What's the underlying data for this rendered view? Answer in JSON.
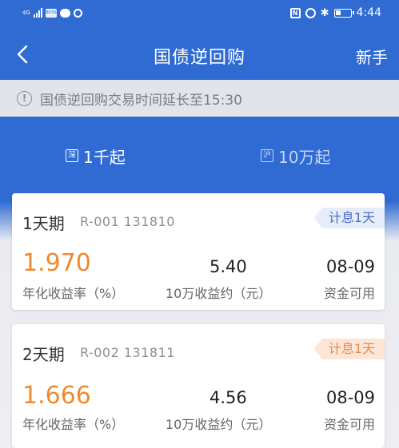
{
  "status_bar": {
    "network": "4G",
    "time": "4:44",
    "app_badge": "BOSS"
  },
  "nav": {
    "title": "国债逆回购",
    "action_label": "新手"
  },
  "notice": {
    "text": "国债逆回购交易时间延长至15:30"
  },
  "tabs": [
    {
      "icon_char": "深",
      "label": "1千起",
      "active": true
    },
    {
      "icon_char": "沪",
      "label": "10万起",
      "active": false
    }
  ],
  "products": [
    {
      "title": "1天期",
      "code": "R-001  131810",
      "badge": "计息1天",
      "rate": "1.970",
      "rate_label": "年化收益率（%）",
      "income": "5.40",
      "income_label": "10万收益约（元）",
      "date": "08-09",
      "date_label": "资金可用"
    },
    {
      "title": "2天期",
      "code": "R-002  131811",
      "badge": "计息1天",
      "rate": "1.666",
      "rate_label": "年化收益率（%）",
      "income": "4.56",
      "income_label": "10万收益约（元）",
      "date": "08-09",
      "date_label": "资金可用"
    }
  ],
  "colors": {
    "primary": "#2f6bd3",
    "rate": "#f08a2e",
    "badge_blue": "#4a6fc0",
    "badge_orange": "#e8894a"
  }
}
